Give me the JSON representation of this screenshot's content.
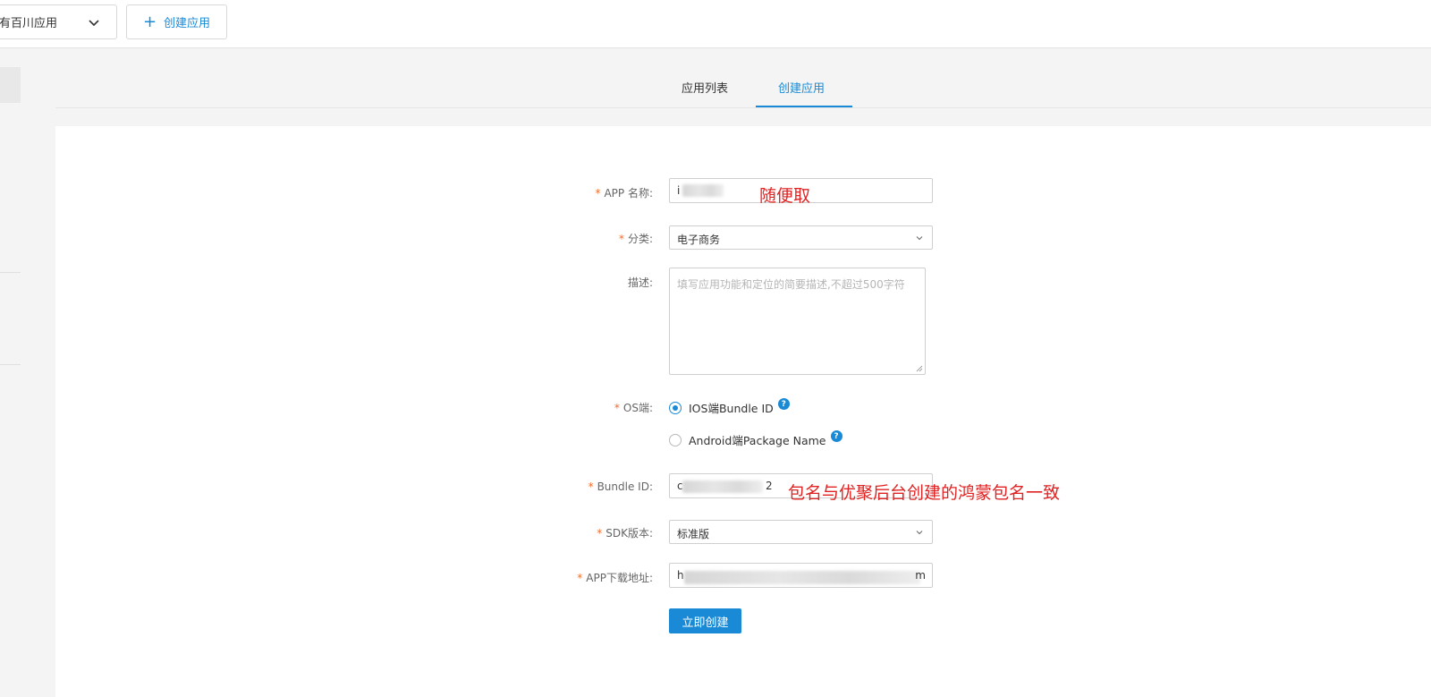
{
  "topbar": {
    "app_select_value": "有百川应用",
    "create_app_label": "创建应用"
  },
  "tabs": [
    {
      "label": "应用列表",
      "active": false
    },
    {
      "label": "创建应用",
      "active": true
    }
  ],
  "form": {
    "app_name": {
      "label": "APP 名称:",
      "required": true,
      "value": "i"
    },
    "category": {
      "label": "分类:",
      "required": true,
      "value": "电子商务"
    },
    "description": {
      "label": "描述:",
      "required": false,
      "placeholder": "填写应用功能和定位的简要描述,不超过500字符"
    },
    "os": {
      "label": "OS端:",
      "required": true,
      "options": [
        {
          "label": "IOS端Bundle ID",
          "selected": true
        },
        {
          "label": "Android端Package Name",
          "selected": false
        }
      ],
      "help_glyph": "?"
    },
    "bundle_id": {
      "label": "Bundle ID:",
      "required": true,
      "value": "c",
      "value_end": "2"
    },
    "sdk_version": {
      "label": "SDK版本:",
      "required": true,
      "value": "标准版"
    },
    "download_url": {
      "label": "APP下载地址:",
      "required": true,
      "value": "h",
      "value_end": "m"
    },
    "submit_label": "立即创建",
    "required_mark": "*"
  },
  "annotations": {
    "app_name_note": "随便取",
    "bundle_id_note": "包名与优聚后台创建的鸿蒙包名一致"
  },
  "colors": {
    "accent": "#1a8ad6",
    "required": "#f56c2a",
    "annotation": "#e02222"
  }
}
